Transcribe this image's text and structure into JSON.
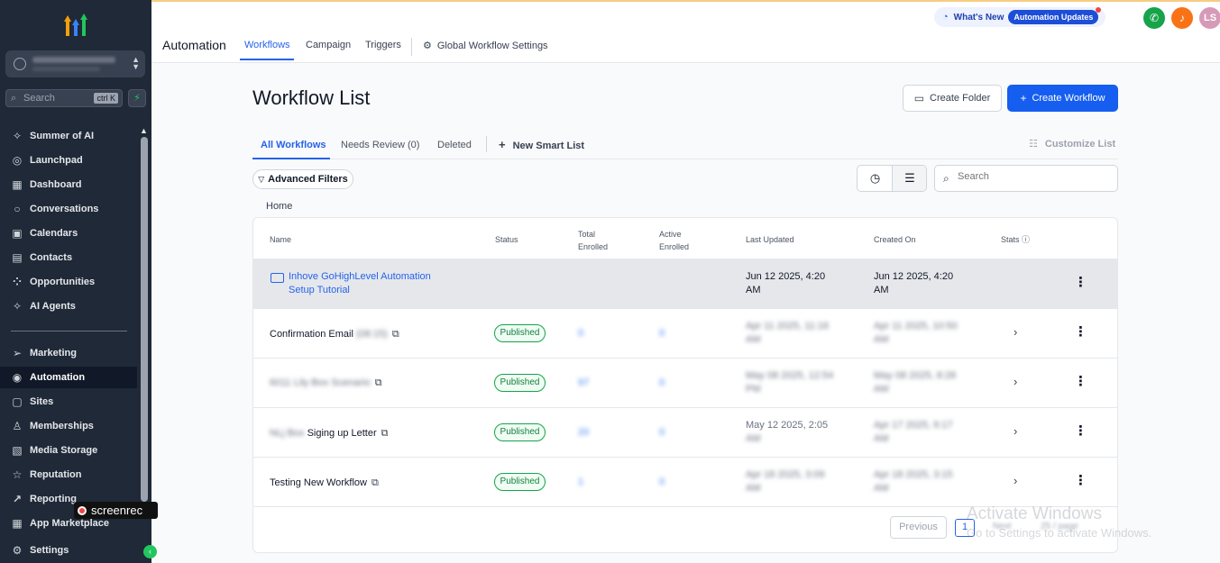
{
  "sidebar": {
    "search": {
      "placeholder": "Search",
      "shortcut": "ctrl K"
    },
    "items": [
      {
        "label": "Summer of AI",
        "icon": "sparkle-icon"
      },
      {
        "label": "Launchpad",
        "icon": "rocket-icon"
      },
      {
        "label": "Dashboard",
        "icon": "grid-icon"
      },
      {
        "label": "Conversations",
        "icon": "chat-icon"
      },
      {
        "label": "Calendars",
        "icon": "calendar-icon"
      },
      {
        "label": "Contacts",
        "icon": "contacts-icon"
      },
      {
        "label": "Opportunities",
        "icon": "opportunities-icon"
      },
      {
        "label": "AI Agents",
        "icon": "sparkle-icon"
      },
      {
        "label": "Marketing",
        "icon": "send-icon"
      },
      {
        "label": "Automation",
        "icon": "automation-icon",
        "active": true
      },
      {
        "label": "Sites",
        "icon": "sites-icon"
      },
      {
        "label": "Memberships",
        "icon": "memberships-icon"
      },
      {
        "label": "Media Storage",
        "icon": "image-icon"
      },
      {
        "label": "Reputation",
        "icon": "star-icon"
      },
      {
        "label": "Reporting",
        "icon": "trend-icon"
      },
      {
        "label": "App Marketplace",
        "icon": "apps-icon"
      },
      {
        "label": "Settings",
        "icon": "gear-icon"
      }
    ]
  },
  "overlay": {
    "screenrec": "screenrec"
  },
  "header": {
    "whats_new": "What's New",
    "updates_pill": "Automation Updates",
    "avatar_initials": "LS",
    "app_title": "Automation",
    "nav": [
      "Workflows",
      "Campaign",
      "Triggers",
      "Global Workflow Settings"
    ]
  },
  "main": {
    "title": "Workflow List",
    "create_folder": "Create Folder",
    "create_workflow": "Create Workflow",
    "tabs": [
      "All Workflows",
      "Needs Review (0)",
      "Deleted"
    ],
    "new_smart_list": "New Smart List",
    "customize_list": "Customize List",
    "advanced_filters": "Advanced Filters",
    "search_placeholder": "Search",
    "breadcrumb": "Home"
  },
  "table": {
    "headers": {
      "name": "Name",
      "status": "Status",
      "total1": "Total",
      "total2": "Enrolled",
      "active1": "Active",
      "active2": "Enrolled",
      "last_updated": "Last Updated",
      "created_on": "Created On",
      "stats": "Stats"
    },
    "folder_row": {
      "name1": "Inhove GoHighLevel Automation",
      "name2": "Setup Tutorial",
      "updated1": "Jun 12 2025, 4:20",
      "updated2": "AM",
      "created1": "Jun 12 2025, 4:20",
      "created2": "AM"
    },
    "rows": [
      {
        "name": "Confirmation Email",
        "name_blur": "(08:15)",
        "status": "Published",
        "total": "0",
        "active": "0",
        "updated1": "Apr 11 2025, 11:16",
        "updated2": "AM",
        "created1": "Apr 11 2025, 10:50",
        "created2": "AM"
      },
      {
        "name": "",
        "name_blur": "6011 Lily Box Scenario",
        "status": "Published",
        "total": "97",
        "active": "0",
        "updated1": "May 08 2025, 12:54",
        "updated2": "PM",
        "created1": "May 08 2025, 8:28",
        "created2": "AM"
      },
      {
        "name": "Siging up Letter",
        "name_blur": "NLj Box",
        "status": "Published",
        "total": "20",
        "active": "0",
        "updated1": "May 12 2025, 2:05",
        "updated2": "AM",
        "created1": "Apr 17 2025, 9:17",
        "created2": "AM"
      },
      {
        "name": "Testing New Workflow",
        "name_blur": "",
        "status": "Published",
        "total": "1",
        "active": "0",
        "updated1": "Apr 18 2025, 3:09",
        "updated2": "AM",
        "created1": "Apr 18 2025, 3:15",
        "created2": "AM"
      }
    ],
    "pagination": {
      "previous": "Previous",
      "page": "1",
      "next": "Next",
      "per_page": "25 / page"
    }
  },
  "watermark": {
    "line1": "Activate Windows",
    "line2": "Go to Settings to activate Windows."
  }
}
